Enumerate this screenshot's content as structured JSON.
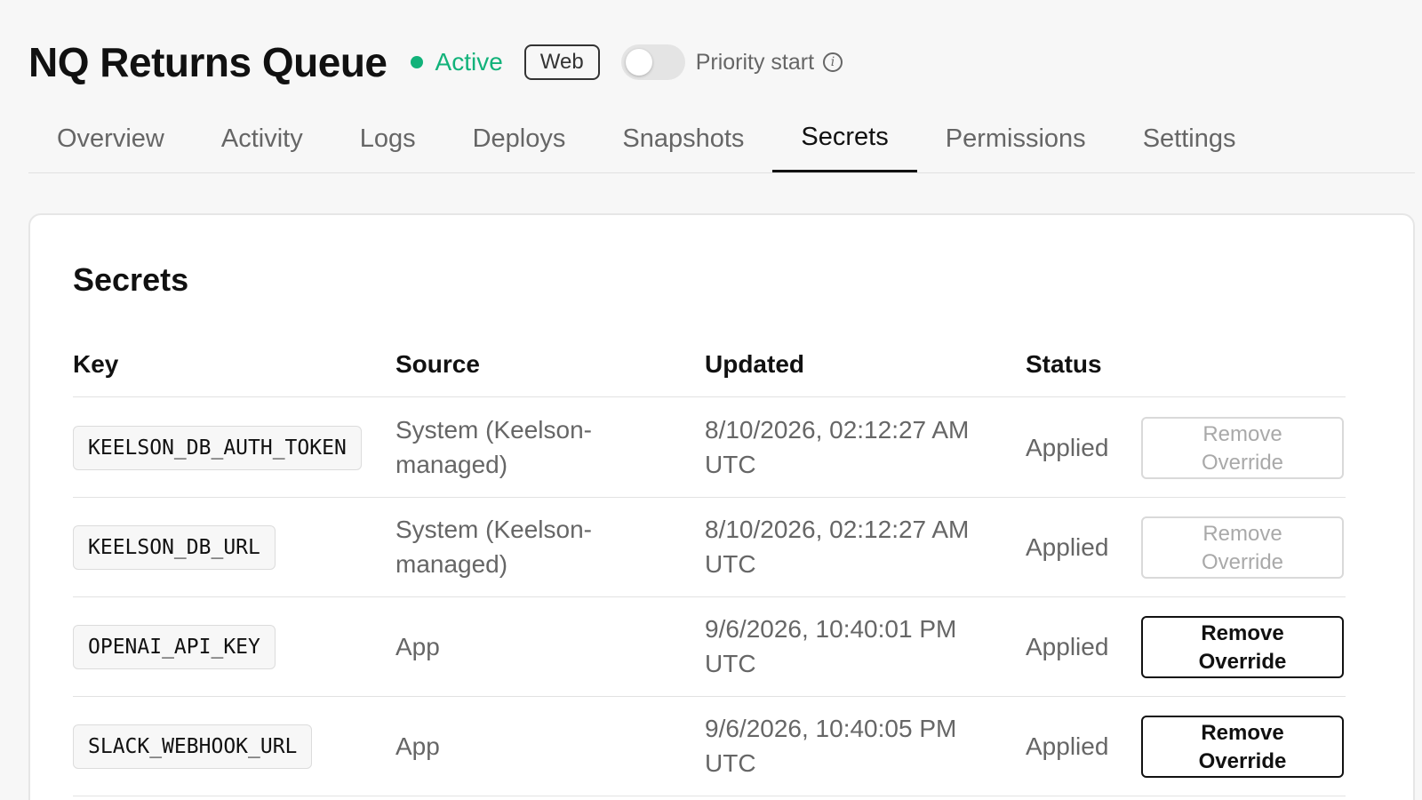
{
  "header": {
    "title": "NQ Returns Queue",
    "status_label": "Active",
    "status_color": "#12b27a",
    "env_badge": "Web",
    "priority_toggle_label": "Priority start",
    "priority_toggle_on": false,
    "info_icon": "i"
  },
  "tabs": [
    {
      "label": "Overview"
    },
    {
      "label": "Activity"
    },
    {
      "label": "Logs"
    },
    {
      "label": "Deploys"
    },
    {
      "label": "Snapshots"
    },
    {
      "label": "Secrets",
      "active": true
    },
    {
      "label": "Permissions"
    },
    {
      "label": "Settings"
    }
  ],
  "secrets": {
    "title": "Secrets",
    "columns": {
      "key": "Key",
      "source": "Source",
      "updated": "Updated",
      "status": "Status"
    },
    "rows": [
      {
        "key": "KEELSON_DB_AUTH_TOKEN",
        "source": "System (Keelson-managed)",
        "updated": "8/10/2026, 02:12:27 AM UTC",
        "status": "Applied",
        "action": "Remove Override",
        "action_enabled": false
      },
      {
        "key": "KEELSON_DB_URL",
        "source": "System (Keelson-managed)",
        "updated": "8/10/2026, 02:12:27 AM UTC",
        "status": "Applied",
        "action": "Remove Override",
        "action_enabled": false
      },
      {
        "key": "OPENAI_API_KEY",
        "source": "App",
        "updated": "9/6/2026, 10:40:01 PM UTC",
        "status": "Applied",
        "action": "Remove Override",
        "action_enabled": true
      },
      {
        "key": "SLACK_WEBHOOK_URL",
        "source": "App",
        "updated": "9/6/2026, 10:40:05 PM UTC",
        "status": "Applied",
        "action": "Remove Override",
        "action_enabled": true
      }
    ]
  }
}
